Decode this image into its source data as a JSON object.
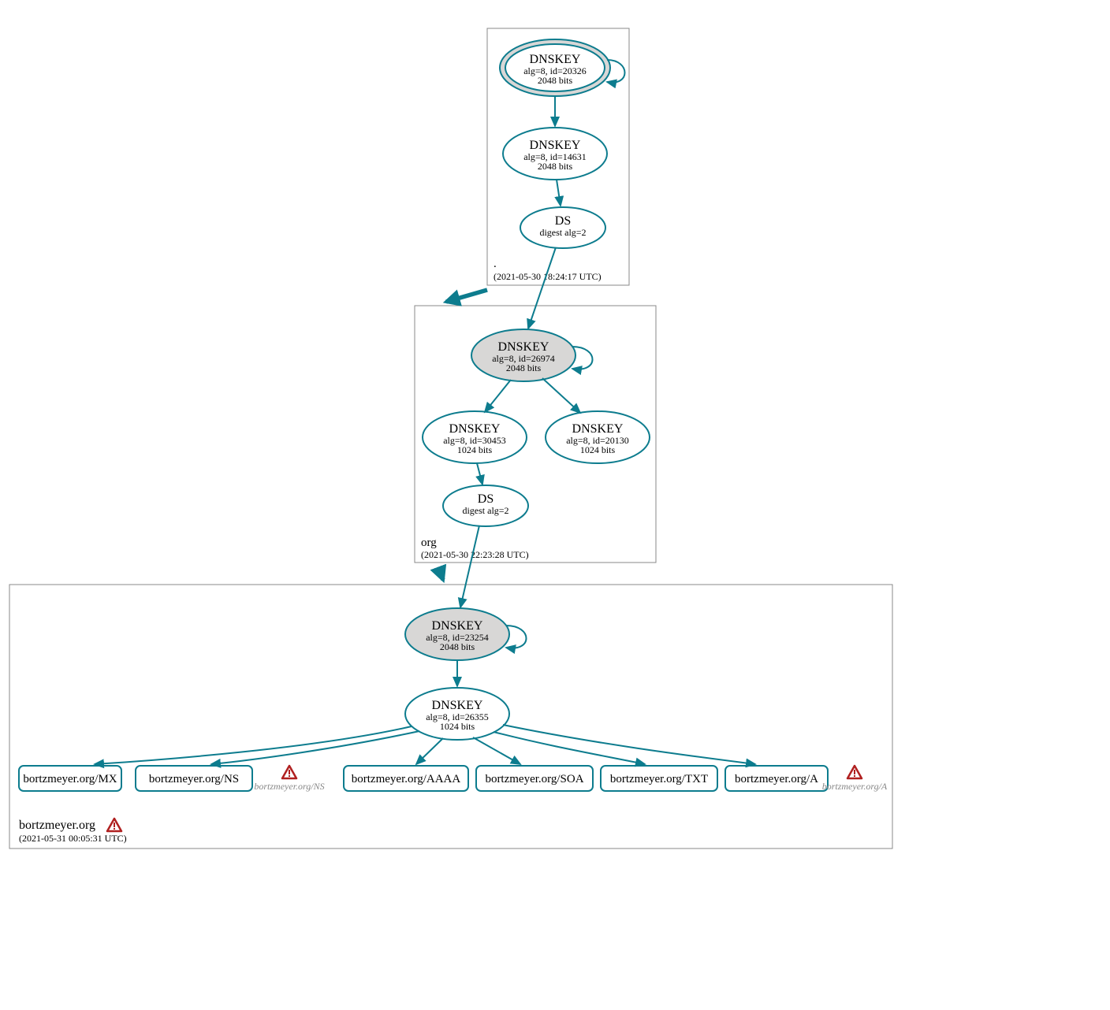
{
  "zones": {
    "root": {
      "label": ".",
      "timestamp": "(2021-05-30 18:24:17 UTC)",
      "dnskey_ksk": {
        "title": "DNSKEY",
        "detail": "alg=8, id=20326",
        "bits": "2048 bits"
      },
      "dnskey_zsk": {
        "title": "DNSKEY",
        "detail": "alg=8, id=14631",
        "bits": "2048 bits"
      },
      "ds": {
        "title": "DS",
        "detail": "digest alg=2"
      }
    },
    "org": {
      "label": "org",
      "timestamp": "(2021-05-30 22:23:28 UTC)",
      "dnskey_ksk": {
        "title": "DNSKEY",
        "detail": "alg=8, id=26974",
        "bits": "2048 bits"
      },
      "dnskey_zsk1": {
        "title": "DNSKEY",
        "detail": "alg=8, id=30453",
        "bits": "1024 bits"
      },
      "dnskey_zsk2": {
        "title": "DNSKEY",
        "detail": "alg=8, id=20130",
        "bits": "1024 bits"
      },
      "ds": {
        "title": "DS",
        "detail": "digest alg=2"
      }
    },
    "bortzmeyer": {
      "label": "bortzmeyer.org",
      "timestamp": "(2021-05-31 00:05:31 UTC)",
      "dnskey_ksk": {
        "title": "DNSKEY",
        "detail": "alg=8, id=23254",
        "bits": "2048 bits"
      },
      "dnskey_zsk": {
        "title": "DNSKEY",
        "detail": "alg=8, id=26355",
        "bits": "1024 bits"
      },
      "rr_mx": "bortzmeyer.org/MX",
      "rr_ns": "bortzmeyer.org/NS",
      "rr_aaaa": "bortzmeyer.org/AAAA",
      "rr_soa": "bortzmeyer.org/SOA",
      "rr_txt": "bortzmeyer.org/TXT",
      "rr_a": "bortzmeyer.org/A",
      "warn_ns": "bortzmeyer.org/NS",
      "warn_a": "bortzmeyer.org/A"
    }
  }
}
